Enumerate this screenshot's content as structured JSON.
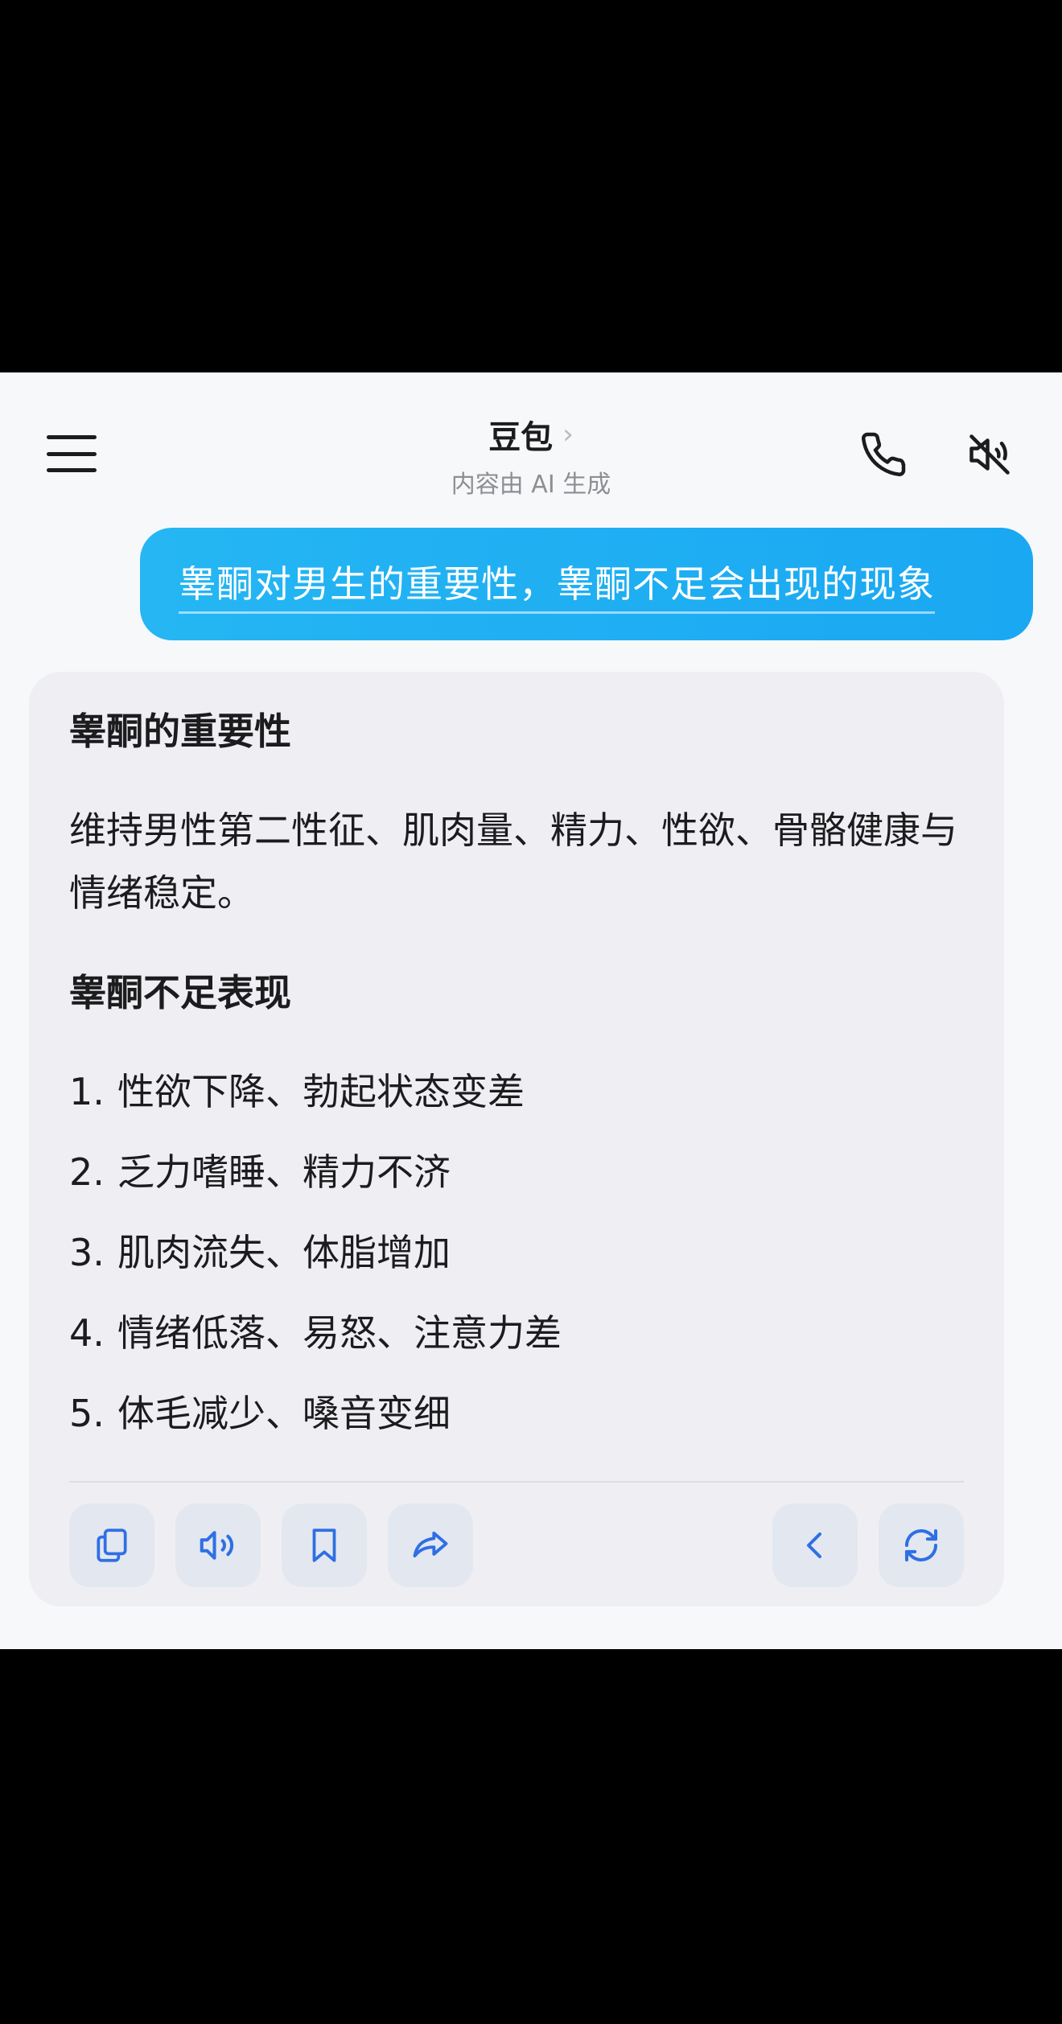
{
  "header": {
    "menu_icon": "hamburger-menu-icon",
    "title": "豆包",
    "title_chevron": "›",
    "subtitle": "内容由 AI 生成",
    "call_icon": "phone-icon",
    "mute_icon": "speaker-muted-icon"
  },
  "user_message": {
    "text": "睾酮对男生的重要性，睾酮不足会出现的现象"
  },
  "answer": {
    "heading1": "睾酮的重要性",
    "paragraph": "维持男性第二性征、肌肉量、精力、性欲、骨骼健康与情绪稳定。",
    "heading2": "睾酮不足表现",
    "list": [
      {
        "num": "1.",
        "text": "性欲下降、勃起状态变差"
      },
      {
        "num": "2.",
        "text": "乏力嗜睡、精力不济"
      },
      {
        "num": "3.",
        "text": "肌肉流失、体脂增加"
      },
      {
        "num": "4.",
        "text": "情绪低落、易怒、注意力差"
      },
      {
        "num": "5.",
        "text": "体毛减少、嗓音变细"
      }
    ]
  },
  "actions": [
    "copy-icon",
    "read-aloud-icon",
    "bookmark-icon",
    "share-icon",
    "previous-icon",
    "regenerate-icon"
  ],
  "colors": {
    "accent": "#1aa8f2",
    "icon_blue": "#2f6fe4",
    "screen_bg": "#f7f8fa",
    "card_bg": "#efeff3"
  }
}
